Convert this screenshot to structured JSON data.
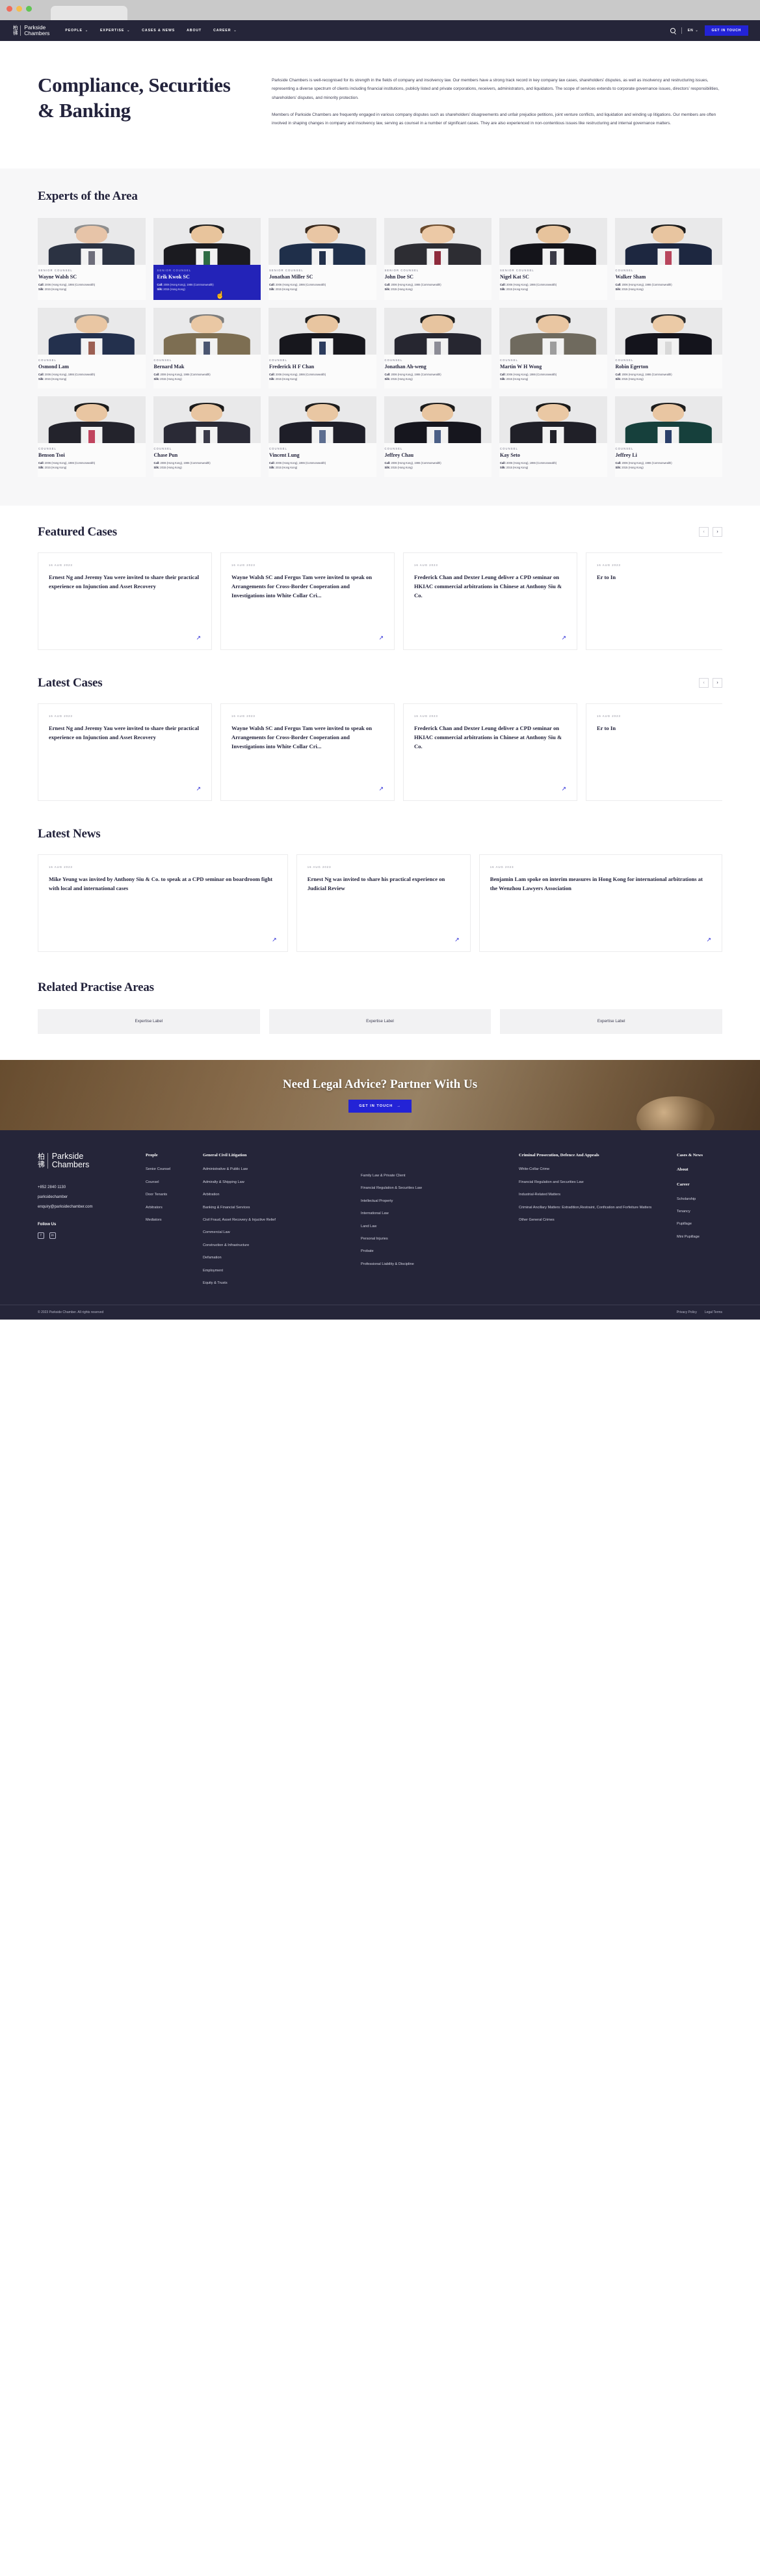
{
  "browser": {
    "tab_title": ""
  },
  "nav": {
    "logo_cjk_top": "柏",
    "logo_cjk_bottom": "彿",
    "logo_line1": "Parkside",
    "logo_line2": "Chambers",
    "links": [
      {
        "label": "PEOPLE",
        "has_caret": true
      },
      {
        "label": "EXPERTISE",
        "has_caret": true
      },
      {
        "label": "CASES & NEWS",
        "has_caret": false
      },
      {
        "label": "ABOUT",
        "has_caret": false
      },
      {
        "label": "CAREER",
        "has_caret": true
      }
    ],
    "lang": "EN",
    "cta": "GET IN TOUCH"
  },
  "hero": {
    "title": "Compliance, Securities & Banking",
    "paragraph1": "Parkside Chambers is well-recognised for its strength in the fields of company and insolvency law. Our members have a strong track record in key company law cases, shareholders’ disputes, as well as insolvency and restructuring issues, representing a diverse spectrum of clients including financial institutions, publicly listed and private corporations, receivers, administrators, and liquidators. The scope of services extends to corporate governance issues, directors’ responsibilities, shareholders’ disputes, and minority protection.",
    "paragraph2": "Members of Parkside Chambers are frequently engaged in various company disputes such as shareholders’ disagreements and unfair prejudice petitions, joint venture conflicts, and liquidation and winding up litigations. Our members are often involved in shaping changes in company and insolvency law, serving as counsel in a number of significant cases. They are also experienced in non-contentious issues like restructuring and internal governance matters."
  },
  "experts": {
    "title": "Experts of the Area",
    "call_label": "Call:",
    "call_value": "2006 (Hong Kong), 1986 (Commonwealth)",
    "silk_label": "Silk:",
    "silk_value": "2015 (Hong Kong)",
    "people": [
      {
        "role": "SENIOR COUNSEL",
        "name": "Wayne Walsh SC",
        "active": false,
        "skin": "#e7c4a8",
        "hair": "#8f8f8f",
        "suit": "#2b3242",
        "tie": "#6d6d7a"
      },
      {
        "role": "SENIOR COUNSEL",
        "name": "Erik Kwok SC",
        "active": true,
        "skin": "#e8c49c",
        "hair": "#1d1d1d",
        "suit": "#1b1b20",
        "tie": "#2e6b43"
      },
      {
        "role": "SENIOR COUNSEL",
        "name": "Jonathan Miller SC",
        "active": false,
        "skin": "#e9c6a4",
        "hair": "#3a2a1e",
        "suit": "#1f2f4a",
        "tie": "#22304a"
      },
      {
        "role": "SENIOR COUNSEL",
        "name": "John Doe SC",
        "active": false,
        "skin": "#ecc9a6",
        "hair": "#6a4a2c",
        "suit": "#2d2d33",
        "tie": "#8e2b3c"
      },
      {
        "role": "SENIOR COUNSEL",
        "name": "Nigel Kat SC",
        "active": false,
        "skin": "#e7c39c",
        "hair": "#25211d",
        "suit": "#14141a",
        "tie": "#3a3a46"
      },
      {
        "role": "COUNSEL",
        "name": "Walker Sham",
        "active": false,
        "skin": "#e8c5a0",
        "hair": "#1a1a1a",
        "suit": "#1d2740",
        "tie": "#b8455c"
      },
      {
        "role": "COUNSEL",
        "name": "Osmond Lam",
        "active": false,
        "skin": "#e9c6a3",
        "hair": "#8a8a8a",
        "suit": "#23304d",
        "tie": "#9b5f52"
      },
      {
        "role": "COUNSEL",
        "name": "Bernard Mak",
        "active": false,
        "skin": "#eac8a4",
        "hair": "#7d7d7d",
        "suit": "#7d6e52",
        "tie": "#4a5570"
      },
      {
        "role": "COUNSEL",
        "name": "Frederick H F Chan",
        "active": false,
        "skin": "#e8c5a0",
        "hair": "#1d1d1d",
        "suit": "#17171d",
        "tie": "#2b3b5c"
      },
      {
        "role": "COUNSEL",
        "name": "Jonathan Ah-weng",
        "active": false,
        "skin": "#e7c49f",
        "hair": "#1c1c1c",
        "suit": "#262630",
        "tie": "#8c8c96"
      },
      {
        "role": "COUNSEL",
        "name": "Martin W H Wong",
        "active": false,
        "skin": "#e9c6a2",
        "hair": "#272727",
        "suit": "#6f6a5e",
        "tie": "#9d9d9d"
      },
      {
        "role": "COUNSEL",
        "name": "Robin Egerton",
        "active": false,
        "skin": "#ebcaa6",
        "hair": "#2b2b2b",
        "suit": "#14141c",
        "tie": "#d8d8d8"
      },
      {
        "role": "COUNSEL",
        "name": "Benson Tsoi",
        "active": false,
        "skin": "#e9c6a2",
        "hair": "#1b1b1b",
        "suit": "#23232c",
        "tie": "#c0445e"
      },
      {
        "role": "COUNSEL",
        "name": "Chase Pun",
        "active": false,
        "skin": "#e8c5a1",
        "hair": "#1b1b1b",
        "suit": "#2a2a36",
        "tie": "#3a3a48"
      },
      {
        "role": "COUNSEL",
        "name": "Vincent Lung",
        "active": false,
        "skin": "#e9c7a3",
        "hair": "#1d1d1d",
        "suit": "#1e1e28",
        "tie": "#5d6e90"
      },
      {
        "role": "COUNSEL",
        "name": "Jeffrey Chau",
        "active": false,
        "skin": "#e8c5a0",
        "hair": "#1c1c1c",
        "suit": "#16161e",
        "tie": "#4b5f86"
      },
      {
        "role": "COUNSEL",
        "name": "Kay Seto",
        "active": false,
        "skin": "#eac8a4",
        "hair": "#1a1a1a",
        "suit": "#202028",
        "tie": "#202028"
      },
      {
        "role": "COUNSEL",
        "name": "Jeffrey Li",
        "active": false,
        "skin": "#e9c6a2",
        "hair": "#1d1d1d",
        "suit": "#16403c",
        "tie": "#2a3f6a"
      }
    ]
  },
  "featured_cases": {
    "title": "Featured Cases",
    "prev": "‹",
    "next": "›",
    "items": [
      {
        "date": "16 AUG 2023",
        "title": "Ernest Ng and Jeremy Yau were invited to share their practical experience on Injunction and Asset Recovery"
      },
      {
        "date": "16 AUG 2023",
        "title": "Wayne Walsh SC and Fergus Tam were invited to speak on Arrangements for Cross-Border Cooperation and Investigations into White Collar Cri..."
      },
      {
        "date": "16 AUG 2023",
        "title": "Frederick Chan and Dexter Leung deliver a CPD seminar on HKIAC commercial arbitrations in Chinese at Anthony Siu & Co."
      },
      {
        "date": "16 AUG 2023",
        "title": "Er to In"
      }
    ]
  },
  "latest_cases": {
    "title": "Latest Cases",
    "prev": "‹",
    "next": "›",
    "items": [
      {
        "date": "16 AUG 2023",
        "title": "Ernest Ng and Jeremy Yau were invited to share their practical experience on Injunction and Asset Recovery"
      },
      {
        "date": "16 AUG 2023",
        "title": "Wayne Walsh SC and Fergus Tam were invited to speak on Arrangements for Cross-Border Cooperation and Investigations into White Collar Cri..."
      },
      {
        "date": "16 AUG 2023",
        "title": "Frederick Chan and Dexter Leung deliver a CPD seminar on HKIAC commercial arbitrations in Chinese at Anthony Siu & Co."
      },
      {
        "date": "16 AUG 2023",
        "title": "Er to In"
      }
    ]
  },
  "latest_news": {
    "title": "Latest News",
    "items": [
      {
        "date": "16 AUG 2023",
        "title": "Mike Yeung was invited by Anthony Siu & Co. to speak at a CPD seminar on boardroom fight with local and international cases"
      },
      {
        "date": "16 AUG 2023",
        "title": "Ernest Ng was invited to share his practical experience on Judicial Review"
      },
      {
        "date": "16 AUG 2023",
        "title": "Benjamin Lam spoke on interim measures in Hong Kong for international arbitrations at the Wenzhou Lawyers Association"
      }
    ]
  },
  "related": {
    "title": "Related Practise Areas",
    "items": [
      "Expertise Label",
      "Expertise Label",
      "Expertise Label"
    ]
  },
  "banner": {
    "heading": "Need Legal Advice? Partner With Us",
    "cta": "GET IN TOUCH"
  },
  "footer": {
    "logo_cjk_top": "柏",
    "logo_cjk_bottom": "彿",
    "logo_line1": "Parkside",
    "logo_line2": "Chambers",
    "phone": "+852 2840 1130",
    "handle": "parksidechamber",
    "email": "enquiry@parksidechamber.com",
    "follow_label": "Follow Us",
    "social": [
      "f",
      "in"
    ],
    "col_people": {
      "head": "People",
      "items": [
        "Senior Counsel",
        "Counsel",
        "Door Tenants",
        "Arbitrators",
        "Mediators"
      ]
    },
    "col_general": {
      "head": "General Civil Litigation",
      "items": [
        "Administrative & Public Law",
        "Admiralty & Shipping Law",
        "Arbitration",
        "Banking & Financial Services",
        "Civil Fraud, Asset Recovery & Injuctive Relief",
        "Commercial Law",
        "Construction & Infrastructure",
        "Defamation",
        "Employment",
        "Equity & Trusts"
      ]
    },
    "col_general2": {
      "head": "",
      "items": [
        "Family Law & Private Client",
        "Financial Regulation & Securities Law",
        "Intellectual Property",
        "International Law",
        "Land Law",
        "Personal Injuries",
        "Probate",
        "Professional Liability & Discipline"
      ]
    },
    "col_criminal": {
      "head": "Criminal Prosecution, Defence And Appeals",
      "items": [
        "White-Collar Crime",
        "Financial Regulation and Securities Law",
        "Industrial-Related Matters",
        "Criminal Ancillary Matters: Extradition,Restraint, Confication and Forfeiture Matters",
        "Other General Crimes"
      ]
    },
    "col_right": {
      "head1": "Cases & News",
      "head2": "About",
      "head3": "Career",
      "items": [
        "Scholarship",
        "Tenancy",
        "Pupillage",
        "Mini Pupillage"
      ]
    },
    "copyright": "© 2023 Parkside Chamber. All rights reserved",
    "privacy": "Privacy Policy",
    "terms": "Legal Terms"
  }
}
